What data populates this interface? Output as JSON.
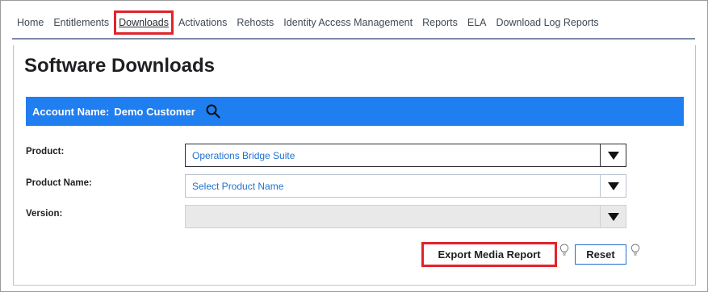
{
  "nav": {
    "items": [
      {
        "label": "Home"
      },
      {
        "label": "Entitlements"
      },
      {
        "label": "Downloads",
        "active": true
      },
      {
        "label": "Activations"
      },
      {
        "label": "Rehosts"
      },
      {
        "label": "Identity Access Management"
      },
      {
        "label": "Reports"
      },
      {
        "label": "ELA"
      },
      {
        "label": "Download Log Reports"
      }
    ]
  },
  "page": {
    "title": "Software Downloads"
  },
  "account": {
    "label": "Account Name:",
    "value": "Demo Customer",
    "search_icon": "search-icon"
  },
  "form": {
    "product": {
      "label": "Product:",
      "value": "Operations Bridge Suite"
    },
    "product_name": {
      "label": "Product Name:",
      "value": "Select Product Name"
    },
    "version": {
      "label": "Version:",
      "value": ""
    }
  },
  "buttons": {
    "export_label": "Export Media Report",
    "reset_label": "Reset"
  },
  "colors": {
    "accent": "#1f7ef0",
    "highlight": "#e0242c",
    "link": "#1f6fd0"
  }
}
